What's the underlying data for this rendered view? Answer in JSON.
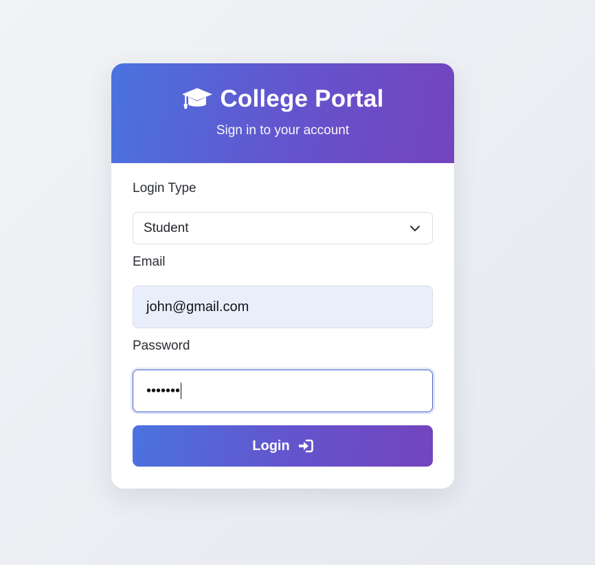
{
  "header": {
    "icon": "graduation-cap-icon",
    "title": "College Portal",
    "subtitle": "Sign in to your account"
  },
  "form": {
    "login_type": {
      "label": "Login Type",
      "selected": "Student"
    },
    "email": {
      "label": "Email",
      "value": "john@gmail.com"
    },
    "password": {
      "label": "Password",
      "masked_value": "•••••••"
    },
    "submit": {
      "label": "Login",
      "icon": "sign-in-icon"
    }
  },
  "colors": {
    "gradient_start": "#4a73df",
    "gradient_end": "#7444be",
    "background": "#eceff4",
    "email_autofill_bg": "#e8effb",
    "focus_border": "#4a63cc"
  }
}
